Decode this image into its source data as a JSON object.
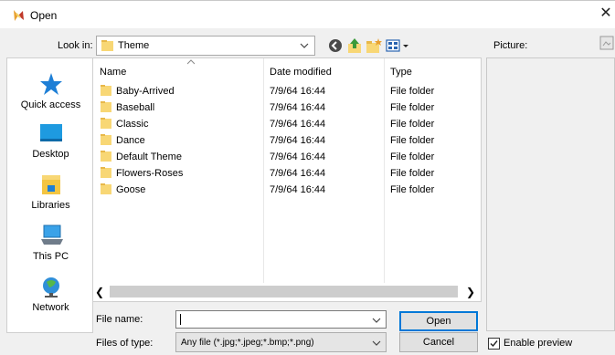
{
  "window": {
    "title": "Open",
    "close_glyph": "✕"
  },
  "look_in": {
    "label": "Look in:",
    "value": "Theme"
  },
  "toolbar": {
    "icons": [
      "back-icon",
      "up-folder-icon",
      "new-folder-icon",
      "view-menu-icon"
    ]
  },
  "places": [
    {
      "label": "Quick access",
      "icon": "star-icon"
    },
    {
      "label": "Desktop",
      "icon": "desktop-icon"
    },
    {
      "label": "Libraries",
      "icon": "libraries-icon"
    },
    {
      "label": "This PC",
      "icon": "computer-icon"
    },
    {
      "label": "Network",
      "icon": "network-icon"
    }
  ],
  "file_list": {
    "columns": [
      "Name",
      "Date modified",
      "Type"
    ],
    "rows": [
      {
        "name": "Baby-Arrived",
        "date": "7/9/64 16:44",
        "type": "File folder"
      },
      {
        "name": "Baseball",
        "date": "7/9/64 16:44",
        "type": "File folder"
      },
      {
        "name": "Classic",
        "date": "7/9/64 16:44",
        "type": "File folder"
      },
      {
        "name": "Dance",
        "date": "7/9/64 16:44",
        "type": "File folder"
      },
      {
        "name": "Default Theme",
        "date": "7/9/64 16:44",
        "type": "File folder"
      },
      {
        "name": "Flowers-Roses",
        "date": "7/9/64 16:44",
        "type": "File folder"
      },
      {
        "name": "Goose",
        "date": "7/9/64 16:44",
        "type": "File folder"
      }
    ]
  },
  "file_name": {
    "label": "File name:",
    "value": ""
  },
  "file_type": {
    "label": "Files of type:",
    "value": "Any file (*.jpg;*.jpeg;*.bmp;*.png)"
  },
  "buttons": {
    "open": "Open",
    "cancel": "Cancel"
  },
  "preview": {
    "label": "Picture:",
    "enable_label": "Enable preview",
    "enabled": true
  },
  "colors": {
    "accent": "#0078d7",
    "folder": "#f8d775",
    "window_bg": "#f0f0f0"
  }
}
